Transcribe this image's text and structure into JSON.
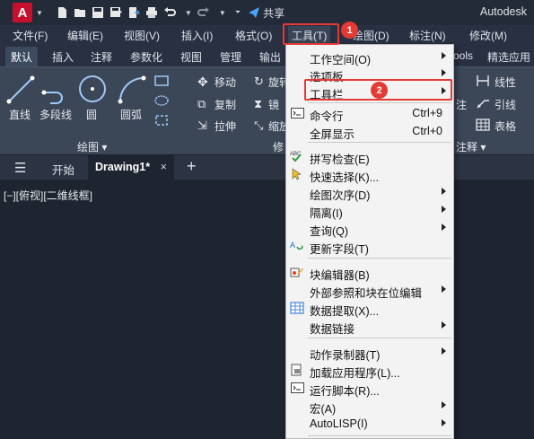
{
  "app": {
    "logo_letter": "A",
    "title": "Autodesk",
    "share_label": "共享"
  },
  "menubar": [
    "文件(F)",
    "编辑(E)",
    "视图(V)",
    "插入(I)",
    "格式(O)",
    "工具(T)",
    "绘图(D)",
    "标注(N)",
    "修改(M)"
  ],
  "ribbon_tabs": [
    "默认",
    "插入",
    "注释",
    "参数化",
    "视图",
    "管理",
    "输出",
    "ools",
    "精选应用"
  ],
  "ribbon": {
    "draw_tools": [
      "直线",
      "多段线",
      "圆",
      "圆弧"
    ],
    "modify_tools": [
      "移动",
      "复制",
      "拉伸",
      "旋转",
      "镜",
      "缩放"
    ],
    "annotation_tools": [
      "线性",
      "引线",
      "表格",
      "注"
    ],
    "panel_labels": [
      "绘图 ▾",
      "修",
      "注释 ▾"
    ]
  },
  "doc_tabs": {
    "start": "开始",
    "active": "Drawing1*",
    "close": "×",
    "add": "+"
  },
  "viewport_label": "[−][俯视][二维线框]",
  "annotations": {
    "badge1": "1",
    "badge2": "2"
  },
  "dropdown": {
    "items": [
      {
        "label": "工作空间(O)",
        "submenu": true
      },
      {
        "label": "选项板",
        "submenu": true
      },
      {
        "label": "工具栏",
        "submenu": true
      },
      {
        "label": "命令行",
        "shortcut": "Ctrl+9",
        "icon": "command-line"
      },
      {
        "label": "全屏显示",
        "shortcut": "Ctrl+0"
      },
      {
        "label": "拼写检查(E)",
        "icon": "spellcheck"
      },
      {
        "label": "快速选择(K)...",
        "icon": "quick-select"
      },
      {
        "label": "绘图次序(D)",
        "submenu": true
      },
      {
        "label": "隔离(I)",
        "submenu": true
      },
      {
        "label": "查询(Q)",
        "submenu": true
      },
      {
        "label": "更新字段(T)",
        "icon": "update-field"
      },
      {
        "label": "块编辑器(B)",
        "icon": "block-editor"
      },
      {
        "label": "外部参照和块在位编辑",
        "submenu": true
      },
      {
        "label": "数据提取(X)...",
        "icon": "data-extraction"
      },
      {
        "label": "数据链接",
        "submenu": true
      },
      {
        "label": "动作录制器(T)",
        "submenu": true
      },
      {
        "label": "加载应用程序(L)...",
        "icon": "load-app"
      },
      {
        "label": "运行脚本(R)...",
        "icon": "run-script"
      },
      {
        "label": "宏(A)",
        "submenu": true
      },
      {
        "label": "AutoLISP(I)",
        "submenu": true
      }
    ]
  },
  "colors": {
    "highlight": "#e53935",
    "accent_blue": "#1e6fd9",
    "background": "#1e2530"
  }
}
